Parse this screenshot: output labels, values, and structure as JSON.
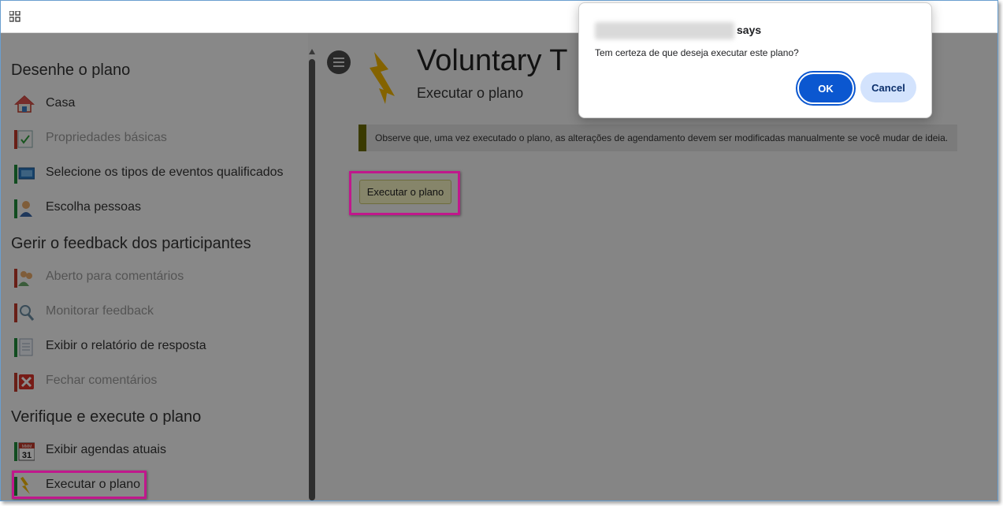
{
  "dialog": {
    "says": "says",
    "message": "Tem certeza de que deseja executar este plano?",
    "ok_label": "OK",
    "cancel_label": "Cancel"
  },
  "sidebar": {
    "sections": [
      {
        "title": "Desenhe o plano"
      },
      {
        "title": "Gerir o feedback dos participantes"
      },
      {
        "title": "Verifique e execute o plano"
      }
    ],
    "items": [
      {
        "label": "Casa",
        "icon": "house-icon",
        "enabled": true
      },
      {
        "label": "Propriedades básicas",
        "icon": "clipboard-check-icon",
        "enabled": false
      },
      {
        "label": "Selecione os tipos de eventos qualificados",
        "icon": "monitor-icon",
        "enabled": true
      },
      {
        "label": "Escolha pessoas",
        "icon": "person-icon",
        "enabled": true
      },
      {
        "label": "Aberto para comentários",
        "icon": "people-comment-icon",
        "enabled": false
      },
      {
        "label": "Monitorar feedback",
        "icon": "magnifier-person-icon",
        "enabled": false
      },
      {
        "label": "Exibir o relatório de resposta",
        "icon": "report-icon",
        "enabled": true
      },
      {
        "label": "Fechar comentários",
        "icon": "red-x-icon",
        "enabled": false
      },
      {
        "label": "Exibir agendas atuais",
        "icon": "calendar-icon",
        "enabled": true
      },
      {
        "label": "Executar o plano",
        "icon": "lightning-icon",
        "enabled": true
      }
    ],
    "calendar_month": "MMM",
    "calendar_day": "31"
  },
  "main": {
    "title": "Voluntary T",
    "subtitle": "Executar o plano",
    "notice": "Observe que, uma vez executado o plano, as alterações de agendamento devem ser modificadas manualmente se você mudar de ideia.",
    "run_button_label": "Executar o plano"
  },
  "colors": {
    "highlight": "#c0188c",
    "ok_button": "#0b57d0",
    "cancel_button": "#d3e3fd",
    "notice_bar": "#6b6b00",
    "lightning": "#f0b400"
  }
}
